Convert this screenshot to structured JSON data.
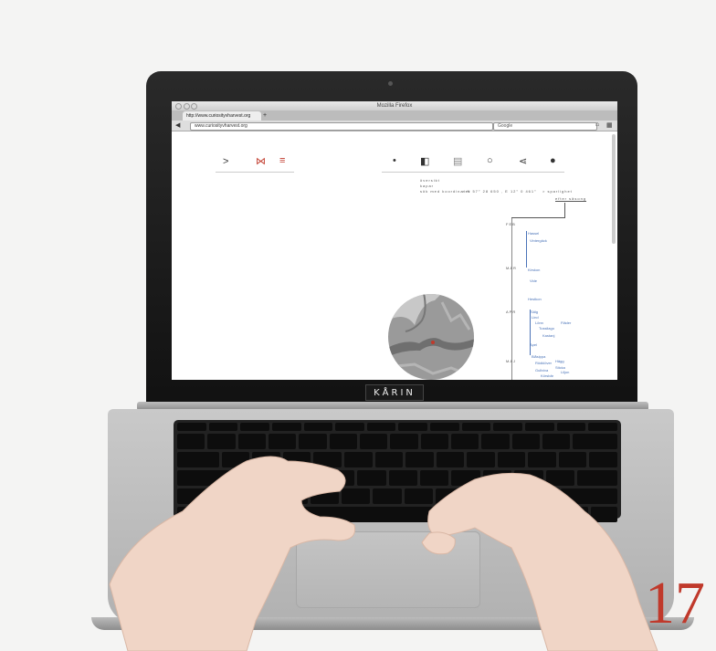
{
  "browser": {
    "window_title": "Mozilla Firefox",
    "tab_label": "http://www.curiosityvharvest.org",
    "url": "www.curiosityvharvest.org",
    "search_placeholder": "Google"
  },
  "page": {
    "nav_left": [
      ">",
      "⋈",
      "≡"
    ],
    "nav_right": [
      "•",
      "◧",
      "▤",
      "○",
      "⋖",
      "●"
    ],
    "info_lines": [
      "översikt",
      "kapar",
      "sök med koordinater"
    ],
    "coords": "> N 57° 28 650 , E 12° 0 461°",
    "sort_label": "> sparlighet",
    "sort_value": "efter säsong",
    "months": [
      "FEB",
      "MAR",
      "APR",
      "MAJ"
    ],
    "timeline_items": [
      "Hassel",
      "Vintergäck",
      "Kirskon",
      "Vide",
      "Hestkon",
      "Sälg",
      "Lind",
      "Lönn",
      "Tussilago",
      "Fläder",
      "Kastanj",
      "Apel",
      "Blåsippa",
      "Rödklöver",
      "Gullviva",
      "Hägg",
      "Sticka",
      "Körsbär",
      "Liljon"
    ]
  },
  "sticker": {
    "text": "KÅRIN"
  },
  "photo_label": {
    "number": "17"
  },
  "colors": {
    "accent": "#c0392b",
    "link": "#4a73b8"
  }
}
